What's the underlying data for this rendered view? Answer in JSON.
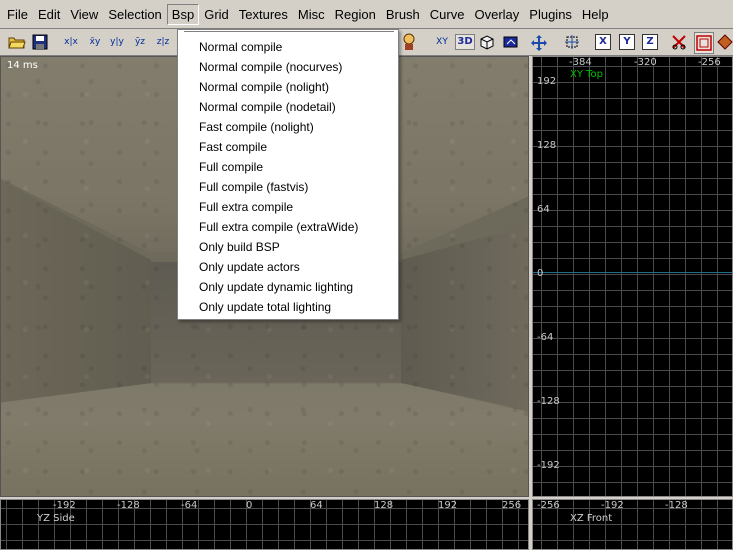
{
  "menubar": {
    "items": [
      "File",
      "Edit",
      "View",
      "Selection",
      "Bsp",
      "Grid",
      "Textures",
      "Misc",
      "Region",
      "Brush",
      "Curve",
      "Overlay",
      "Plugins",
      "Help"
    ]
  },
  "toolbar": {
    "buttons": [
      {
        "icon": "open-folder-icon"
      },
      {
        "icon": "save-disk-icon"
      },
      {
        "label": "x|x"
      },
      {
        "label": "x̄y"
      },
      {
        "label": "y|y"
      },
      {
        "label": "ȳz"
      },
      {
        "label": "z|z"
      },
      {
        "label": "XY"
      },
      {
        "label": "3D"
      },
      {
        "label": "X"
      },
      {
        "label": "Y"
      },
      {
        "label": "Z"
      }
    ]
  },
  "bsp_menu": {
    "items": [
      "Normal compile",
      "Normal compile (nocurves)",
      "Normal compile (nolight)",
      "Normal compile (nodetail)",
      "Fast compile (nolight)",
      "Fast compile",
      "Full compile",
      "Full compile (fastvis)",
      "Full extra compile",
      "Full extra compile (extraWide)",
      "Only build BSP",
      "Only update actors",
      "Only update dynamic lighting",
      "Only update total lighting"
    ]
  },
  "camera": {
    "frame_time": "14 ms"
  },
  "xy_view": {
    "title": "XY Top",
    "title_color": "#00c000",
    "top_labels": [
      "-384",
      "-320",
      "-256"
    ],
    "left_labels": [
      "192",
      "128",
      "64",
      "0",
      "-64",
      "-128",
      "-192"
    ]
  },
  "yz_view": {
    "title": "YZ Side",
    "top_labels": [
      "-192",
      "-128",
      "-64",
      "0",
      "64",
      "128",
      "192",
      "256"
    ]
  },
  "xz_view": {
    "title": "XZ Front",
    "top_labels": [
      "-256",
      "-192",
      "-128"
    ]
  },
  "colors": {
    "menu_bg": "#d4d0c8",
    "grid_bg": "#000000",
    "grid_line": "#4b4b4b",
    "axis_line": "#1f6f8a"
  }
}
